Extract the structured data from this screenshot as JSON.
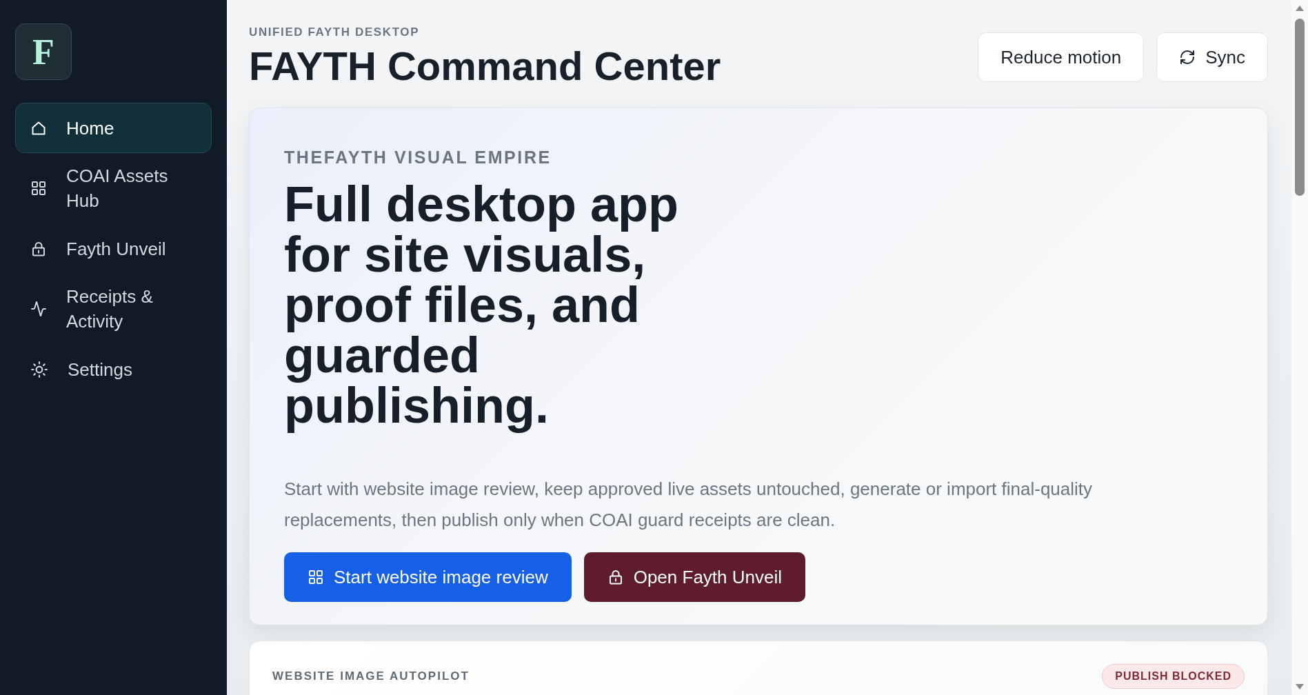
{
  "sidebar": {
    "logo": "F",
    "items": [
      {
        "label": "Home",
        "selected": true
      },
      {
        "label": "COAI Assets Hub",
        "selected": false
      },
      {
        "label": "Fayth Unveil",
        "selected": false
      },
      {
        "label": "Receipts & Activity",
        "selected": false
      },
      {
        "label": "Settings",
        "selected": false
      }
    ]
  },
  "header": {
    "eyebrow": "UNIFIED FAYTH DESKTOP",
    "title": "FAYTH Command Center",
    "actions": [
      {
        "label": "Reduce motion",
        "kind": "plain"
      },
      {
        "label": "Sync",
        "kind": "sync"
      }
    ]
  },
  "hero": {
    "eyebrow": "THEFAYTH VISUAL EMPIRE",
    "headline": "Full desktop app for site visuals, proof files, and guarded publishing.",
    "description": "Start with website image review, keep approved live assets untouched, generate or import final-quality replacements, then publish only when COAI guard receipts are clean.",
    "buttons": [
      {
        "label": "Start website image review",
        "kind": "primary"
      },
      {
        "label": "Open Fayth Unveil",
        "kind": "danger"
      }
    ]
  },
  "autopilot_card": {
    "eyebrow": "WEBSITE IMAGE AUTOPILOT",
    "badge": "PUBLISH BLOCKED"
  }
}
